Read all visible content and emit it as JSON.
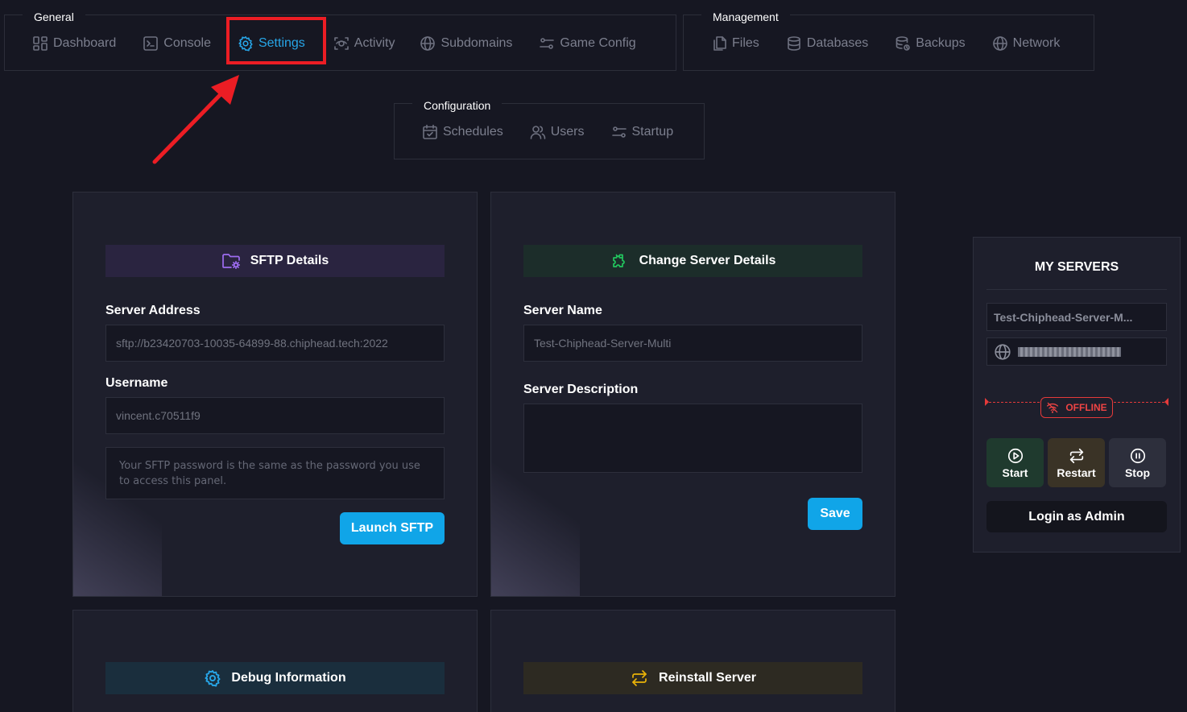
{
  "nav": {
    "general": {
      "legend": "General",
      "items": [
        {
          "label": "Dashboard",
          "icon": "dashboard-icon"
        },
        {
          "label": "Console",
          "icon": "terminal-icon"
        },
        {
          "label": "Settings",
          "icon": "gear-icon",
          "active": true
        },
        {
          "label": "Activity",
          "icon": "activity-icon"
        },
        {
          "label": "Subdomains",
          "icon": "globe-icon"
        },
        {
          "label": "Game Config",
          "icon": "sliders-icon"
        }
      ]
    },
    "management": {
      "legend": "Management",
      "items": [
        {
          "label": "Files",
          "icon": "files-icon"
        },
        {
          "label": "Databases",
          "icon": "database-icon"
        },
        {
          "label": "Backups",
          "icon": "backup-icon"
        },
        {
          "label": "Network",
          "icon": "globe-icon"
        }
      ]
    },
    "configuration": {
      "legend": "Configuration",
      "items": [
        {
          "label": "Schedules",
          "icon": "calendar-icon"
        },
        {
          "label": "Users",
          "icon": "users-icon"
        },
        {
          "label": "Startup",
          "icon": "sliders-icon"
        }
      ]
    }
  },
  "sftp": {
    "title": "SFTP Details",
    "server_address_label": "Server Address",
    "server_address": "sftp://b23420703-10035-64899-88.chiphead.tech:2022",
    "username_label": "Username",
    "username": "vincent.c70511f9",
    "password_note": "Your SFTP password is the same as the password you use to access this panel.",
    "launch_label": "Launch SFTP"
  },
  "change_server": {
    "title": "Change Server Details",
    "server_name_label": "Server Name",
    "server_name": "Test-Chiphead-Server-Multi",
    "server_description_label": "Server Description",
    "server_description": "",
    "save_label": "Save"
  },
  "debug": {
    "title": "Debug Information"
  },
  "reinstall": {
    "title": "Reinstall Server"
  },
  "my_servers": {
    "title": "MY SERVERS",
    "server_name": "Test-Chiphead-Server-M...",
    "status": "OFFLINE",
    "start_label": "Start",
    "restart_label": "Restart",
    "stop_label": "Stop",
    "login_admin_label": "Login as Admin"
  },
  "colors": {
    "accent": "#10a5e8",
    "background": "#161722",
    "card": "#1e1f2c",
    "offline": "#ef4444",
    "highlight": "#ec1d24",
    "sftp_header": "#2a2440",
    "change_header": "#1c2d2a",
    "debug_header": "#1a2e3d",
    "reinstall_header": "#2d2a22",
    "start_bg": "#1f3a2e",
    "restart_bg": "#3a3326",
    "stop_bg": "#2d2f3c"
  }
}
